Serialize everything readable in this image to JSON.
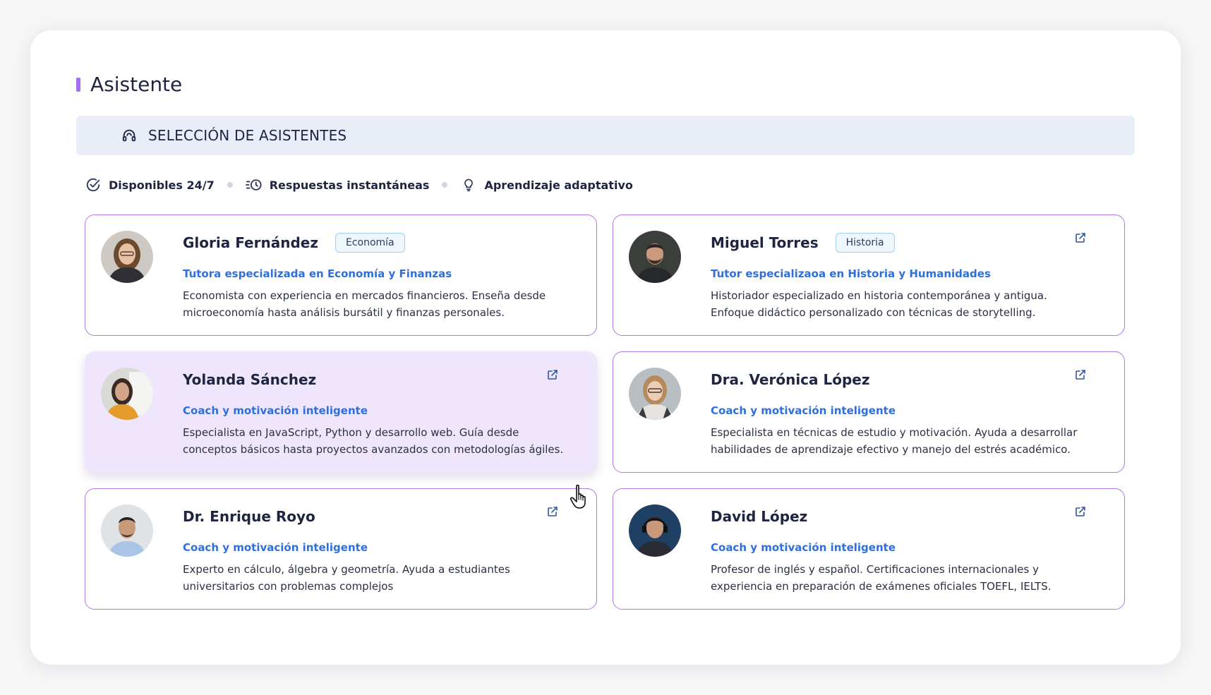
{
  "page": {
    "title": "Asistente"
  },
  "section": {
    "label": "SELECCIÓN DE ASISTENTES",
    "icon": "headset-icon"
  },
  "features": [
    {
      "label": "Disponibles 24/7",
      "icon": "check-circle-icon"
    },
    {
      "label": "Respuestas instantáneas",
      "icon": "clock-history-icon"
    },
    {
      "label": "Aprendizaje adaptativo",
      "icon": "lightbulb-icon"
    }
  ],
  "assistants": [
    {
      "name": "Gloria Fernández",
      "tag": "Economía",
      "role": "Tutora especializada en Economía y Finanzas",
      "description": "Economista con experiencia en mercados financieros. Enseña desde microeconomía hasta análisis bursátil y finanzas personales."
    },
    {
      "name": "Miguel Torres",
      "tag": "Historia",
      "role": "Tutor especializaoa en Historia y Humanidades",
      "description": "Historiador especializado en historia contemporánea y antigua. Enfoque didáctico personalizado con técnicas de storytelling."
    },
    {
      "name": "Yolanda Sánchez",
      "tag": "",
      "role": "Coach y motivación inteligente",
      "description": "Especialista en JavaScript, Python y desarrollo web. Guía desde conceptos básicos hasta proyectos avanzados con metodologías ágiles."
    },
    {
      "name": "Dra. Verónica López",
      "tag": "",
      "role": "Coach y motivación inteligente",
      "description": "Especialista en técnicas de estudio y motivación. Ayuda a desarrollar habilidades de aprendizaje efectivo y manejo del estrés académico."
    },
    {
      "name": "Dr. Enrique Royo",
      "tag": "",
      "role": "Coach y motivación inteligente",
      "description": "Experto en cálculo, álgebra y geometría. Ayuda a estudiantes universitarios con problemas complejos"
    },
    {
      "name": "David López",
      "tag": "",
      "role": "Coach y motivación inteligente",
      "description": "Profesor de inglés y español. Certificaciones internacionales y experiencia en preparación de exámenes oficiales TOEFL, IELTS."
    }
  ],
  "colors": {
    "accent": "#a56ef0",
    "role_blue": "#2f6fdd",
    "card_border": "#b078e0",
    "active_card_bg": "#efe6fd",
    "banner_bg": "#e8edf7"
  }
}
